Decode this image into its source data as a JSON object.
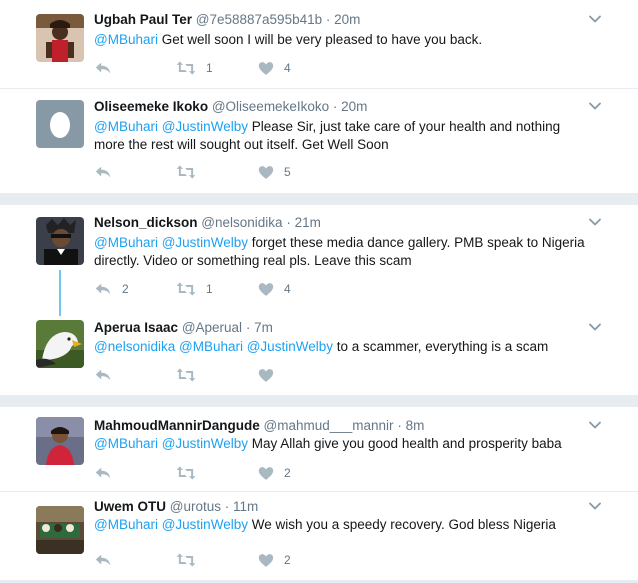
{
  "tweets": [
    {
      "name": "Ugbah Paul Ter",
      "handle": "@7e58887a595b41b",
      "time": "20m",
      "mentions": "@MBuhari",
      "text": " Get well soon I will be very pleased to have you back.",
      "reply_count": "",
      "retweet_count": "1",
      "like_count": "4"
    },
    {
      "name": "Oliseemeke Ikoko",
      "handle": "@OliseemekeIkoko",
      "time": "20m",
      "mentions": "@MBuhari @JustinWelby",
      "text": " Please Sir, just take care of your health and nothing more the rest will sought out itself. Get Well Soon",
      "reply_count": "",
      "retweet_count": "",
      "like_count": "5"
    },
    {
      "name": "Nelson_dickson",
      "handle": "@nelsonidika",
      "time": "21m",
      "mentions": "@MBuhari @JustinWelby",
      "text": " forget these media dance gallery. PMB speak to Nigeria directly. Video or something real pls. Leave this scam",
      "reply_count": "2",
      "retweet_count": "1",
      "like_count": "4"
    },
    {
      "name": "Aperua Isaac",
      "handle": "@Aperual",
      "time": "7m",
      "mentions": "@nelsonidika @MBuhari @JustinWelby",
      "text": "  to a scammer, everything is a scam",
      "reply_count": "",
      "retweet_count": "",
      "like_count": ""
    },
    {
      "name": "MahmoudMannirDangude",
      "handle": "@mahmud___mannir",
      "time": "8m",
      "mentions": "@MBuhari @JustinWelby",
      "text": " May Allah give you good health and prosperity baba",
      "reply_count": "",
      "retweet_count": "",
      "like_count": "2"
    },
    {
      "name": "Uwem OTU",
      "handle": "@urotus",
      "time": "11m",
      "mentions": "@MBuhari @JustinWelby",
      "text": " We wish you a speedy recovery.  God bless Nigeria",
      "reply_count": "",
      "retweet_count": "",
      "like_count": "2"
    }
  ],
  "separator": "·",
  "icons": {
    "reply": "reply-icon",
    "retweet": "retweet-icon",
    "like": "heart-icon",
    "more": "chevron-down-icon"
  },
  "colors": {
    "link": "#1da1f2",
    "muted": "#657786",
    "action": "#aab8c2",
    "thread": "#74c8ee",
    "background": "#e6ecf0"
  }
}
